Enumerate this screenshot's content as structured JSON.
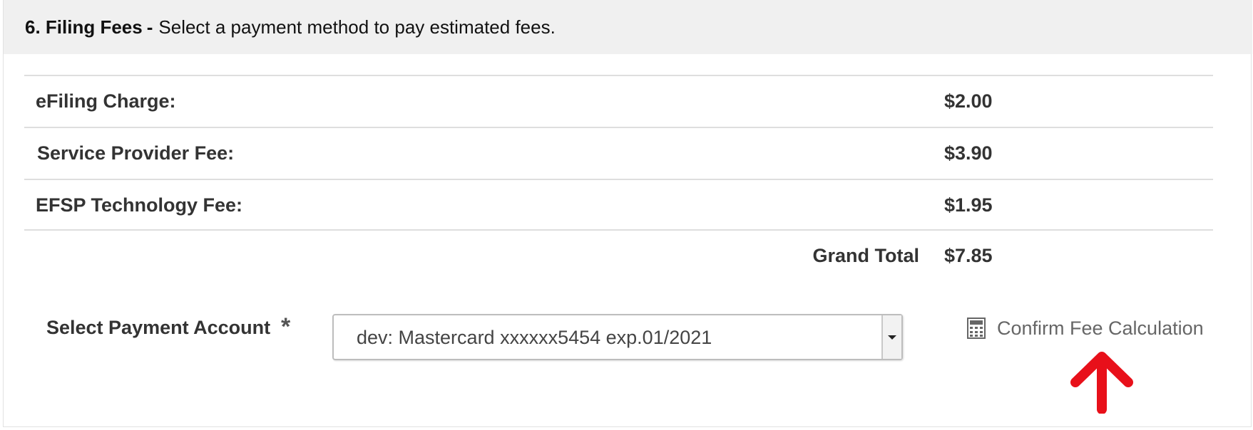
{
  "header": {
    "step": "6. Filing Fees",
    "separator": "-",
    "description": "Select a payment method to pay estimated fees."
  },
  "fees": [
    {
      "label": "eFiling Charge:",
      "amount": "$2.00"
    },
    {
      "label": "Service Provider Fee:",
      "amount": "$3.90"
    },
    {
      "label": "EFSP Technology Fee:",
      "amount": "$1.95"
    }
  ],
  "total": {
    "label": "Grand Total",
    "amount": "$7.85"
  },
  "payment": {
    "label": "Select Payment Account",
    "required_mark": "*",
    "selected": "dev: Mastercard xxxxxx5454 exp.01/2021"
  },
  "confirm": {
    "label": "Confirm Fee Calculation",
    "icon": "calculator-icon"
  },
  "annotation": {
    "icon": "arrow-up-icon",
    "color": "#e8101a"
  }
}
